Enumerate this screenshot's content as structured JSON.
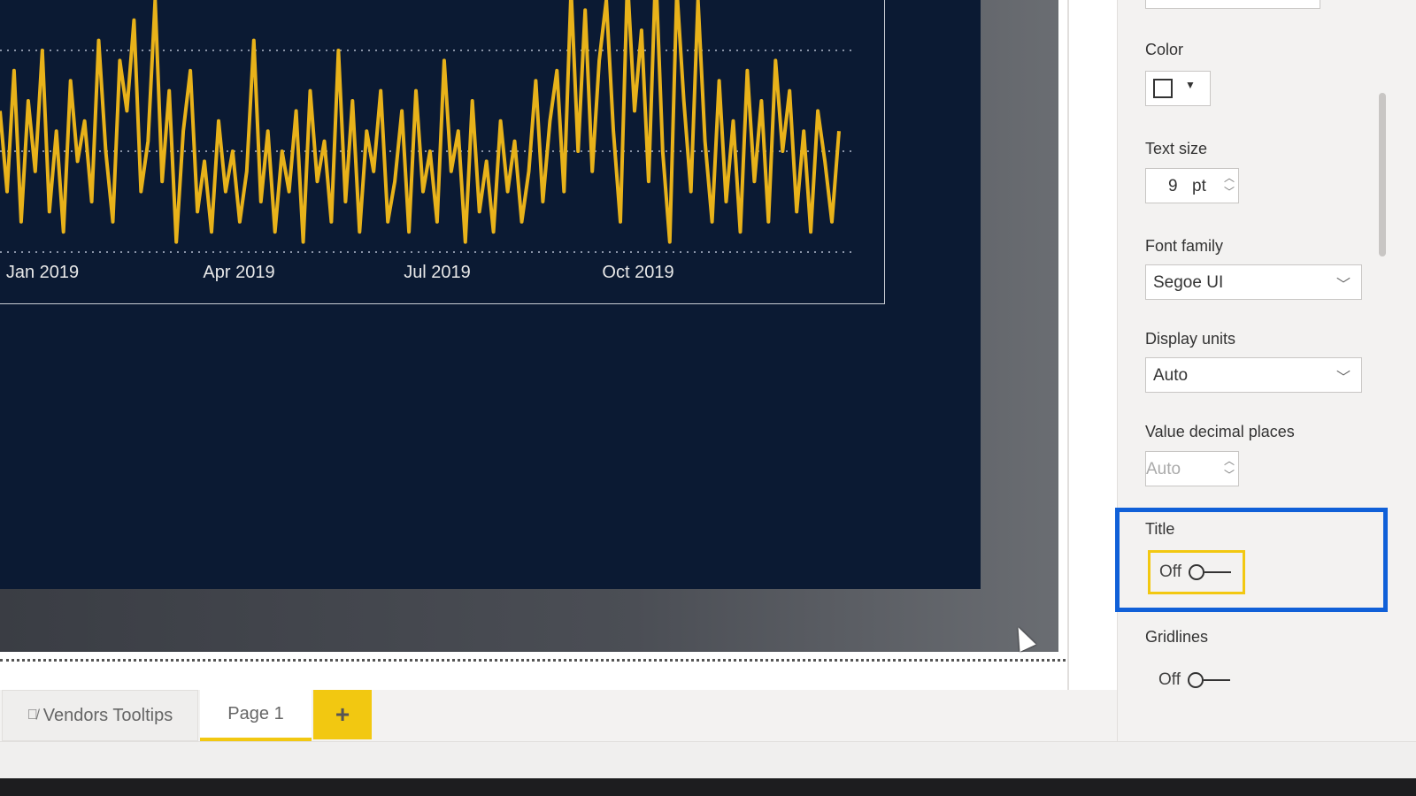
{
  "chart_data": {
    "type": "line",
    "color": "#e8b21a",
    "x_range": [
      "2018-12-10",
      "2019-12-31"
    ],
    "x_tick_labels": [
      "Jan 2019",
      "Apr 2019",
      "Jul 2019",
      "Oct 2019"
    ],
    "grid": true,
    "gridlines_count": 3,
    "values": [
      1.4,
      0.6,
      1.8,
      0.3,
      1.5,
      0.8,
      2.0,
      0.4,
      1.2,
      0.2,
      1.7,
      0.9,
      1.3,
      0.5,
      2.1,
      1.0,
      0.3,
      1.9,
      1.4,
      2.3,
      0.6,
      1.1,
      2.5,
      0.7,
      1.6,
      0.1,
      1.2,
      1.8,
      0.4,
      0.9,
      0.2,
      1.3,
      0.6,
      1.0,
      0.3,
      0.8,
      2.1,
      0.5,
      1.2,
      0.2,
      1.0,
      0.6,
      1.4,
      0.1,
      1.6,
      0.7,
      1.1,
      0.3,
      2.0,
      0.5,
      1.5,
      0.2,
      1.2,
      0.8,
      1.6,
      0.3,
      0.7,
      1.4,
      0.2,
      1.6,
      0.6,
      1.0,
      0.3,
      1.9,
      0.8,
      1.2,
      0.1,
      1.5,
      0.4,
      0.9,
      0.2,
      1.3,
      0.6,
      1.1,
      0.3,
      0.8,
      1.7,
      0.5,
      1.3,
      1.8,
      0.6,
      2.6,
      1.0,
      2.4,
      0.8,
      1.9,
      2.5,
      1.2,
      0.3,
      2.7,
      1.4,
      2.2,
      0.7,
      2.8,
      1.0,
      0.1,
      2.6,
      1.5,
      0.6,
      2.5,
      1.1,
      0.3,
      1.7,
      0.5,
      1.3,
      0.2,
      1.8,
      0.7,
      1.5,
      0.3,
      1.9,
      1.0,
      1.6,
      0.4,
      1.2,
      0.2,
      1.4,
      0.9,
      0.3,
      1.2
    ]
  },
  "format_panel": {
    "color_label": "Color",
    "color_value": "#ffffff",
    "text_size_label": "Text size",
    "text_size_value": "9",
    "text_size_unit": "pt",
    "font_family_label": "Font family",
    "font_family_value": "Segoe UI",
    "display_units_label": "Display units",
    "display_units_value": "Auto",
    "decimal_label": "Value decimal places",
    "decimal_placeholder": "Auto",
    "title_label": "Title",
    "title_toggle": "Off",
    "gridlines_label": "Gridlines",
    "gridlines_toggle": "Off"
  },
  "pages": {
    "tabs": [
      {
        "label": "Vendors Tooltips",
        "hidden": true
      },
      {
        "label": "Page 1",
        "active": true
      }
    ],
    "add_label": "+"
  }
}
